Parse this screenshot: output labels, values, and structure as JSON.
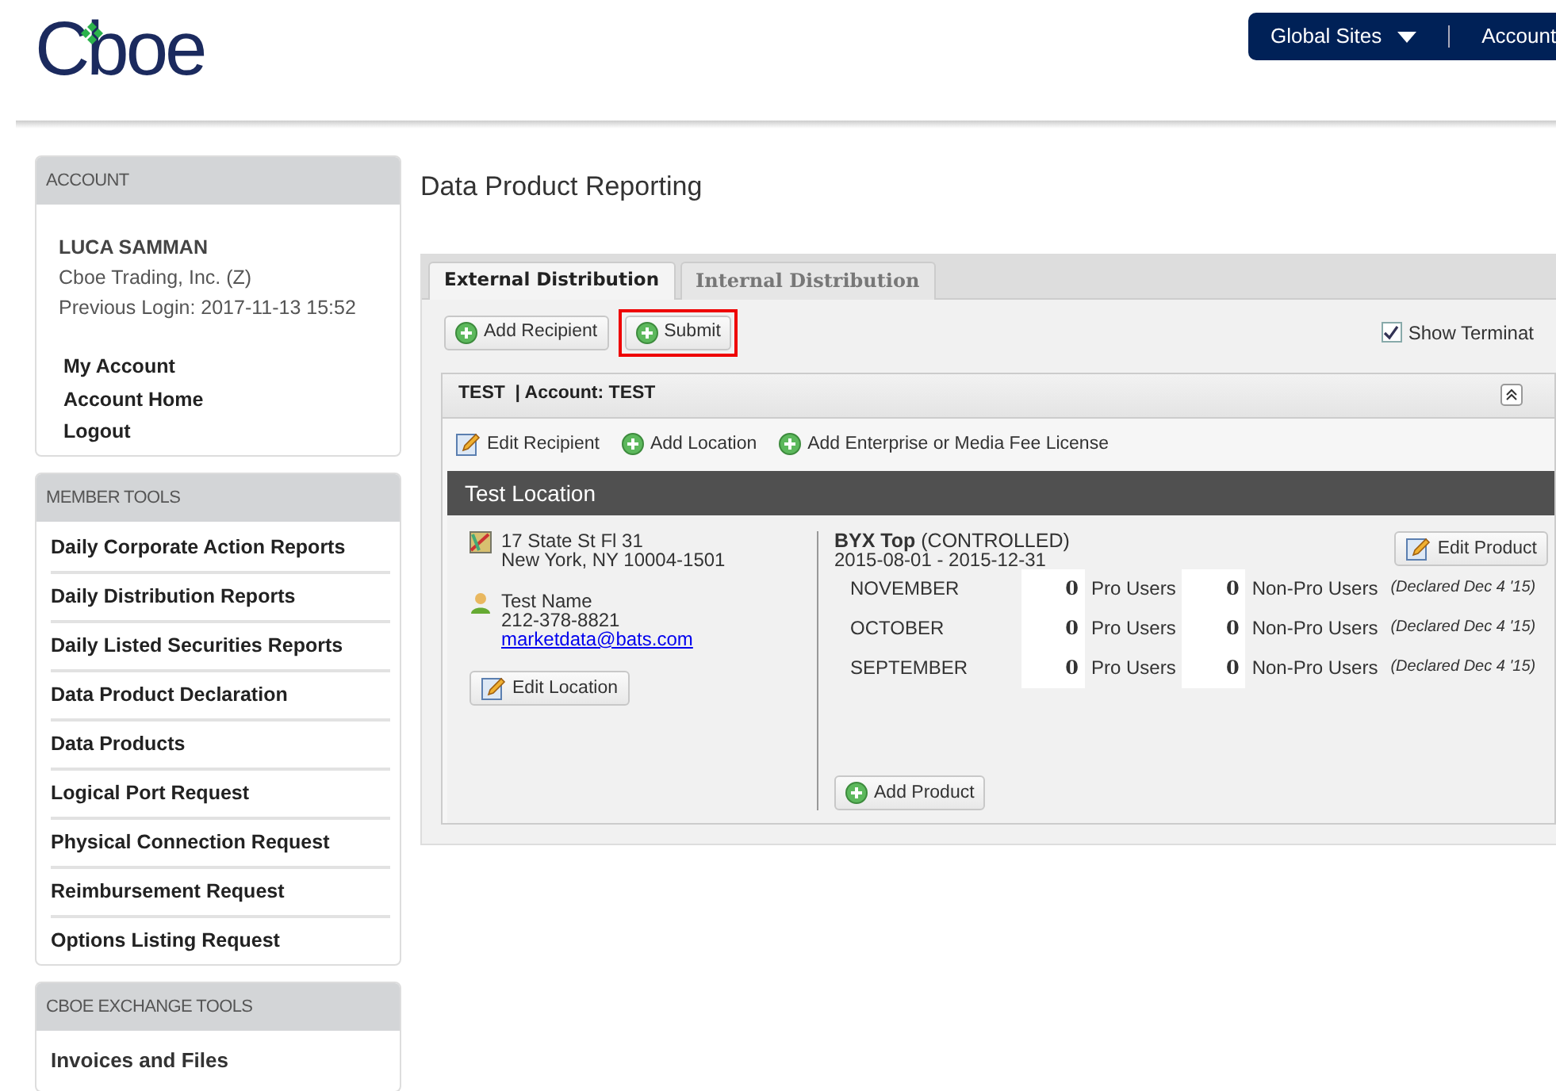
{
  "header": {
    "logo": "Cboe",
    "global_sites": "Global Sites",
    "account_link": "Account"
  },
  "sidebar": [
    {
      "kind": "account",
      "title": "ACCOUNT",
      "user": "LUCA SAMMAN",
      "company": "Cboe Trading, Inc. (Z)",
      "previous_login": "Previous Login: 2017-11-13 15:52",
      "links": [
        "My Account",
        "Account Home",
        "Logout"
      ]
    },
    {
      "kind": "links",
      "title": "MEMBER TOOLS",
      "items": [
        "Daily Corporate Action Reports",
        "Daily Distribution Reports",
        "Daily Listed Securities Reports",
        "Data Product Declaration",
        "Data Products",
        "Logical Port Request",
        "Physical Connection Request",
        "Reimbursement Request",
        "Options Listing Request"
      ]
    },
    {
      "kind": "plain",
      "title": "CBOE EXCHANGE TOOLS",
      "items": [
        "Invoices and Files"
      ]
    }
  ],
  "main": {
    "title": "Data Product Reporting",
    "tabs": [
      {
        "label": "External Distribution",
        "selected": true
      },
      {
        "label": "Internal Distribution",
        "selected": false
      }
    ],
    "buttons": [
      {
        "label": "Add Recipient",
        "highlighted": false
      },
      {
        "label": "Submit",
        "highlighted": true
      }
    ],
    "show_terminated": {
      "label": "Show Terminat",
      "checked": true
    },
    "recipient": {
      "title": "TEST  | Account: TEST",
      "actions": [
        {
          "kind": "edit",
          "label": "Edit Recipient"
        },
        {
          "kind": "add",
          "label": "Add Location"
        },
        {
          "kind": "add",
          "label": "Add Enterprise or Media Fee License"
        }
      ],
      "location": {
        "title": "Test Location",
        "address": [
          "17 State St Fl 31",
          "New York, NY  10004-1501"
        ],
        "contact_name": "Test Name",
        "phone": "212-378-8821",
        "email": "marketdata@bats.com",
        "edit_button": "Edit Location",
        "product": {
          "name": "BYX Top",
          "status": "(CONTROLLED)",
          "dates": "2015-08-01 - 2015-12-31",
          "edit_button": "Edit Product",
          "add_button": "Add Product",
          "rows": [
            {
              "month": "NOVEMBER",
              "pro": "0",
              "pro_label": "Pro Users",
              "nonpro": "0",
              "nonpro_label": "Non-Pro Users",
              "note": "(Declared Dec 4 '15)"
            },
            {
              "month": "OCTOBER",
              "pro": "0",
              "pro_label": "Pro Users",
              "nonpro": "0",
              "nonpro_label": "Non-Pro Users",
              "note": "(Declared Dec 4 '15)"
            },
            {
              "month": "SEPTEMBER",
              "pro": "0",
              "pro_label": "Pro Users",
              "nonpro": "0",
              "nonpro_label": "Non-Pro Users",
              "note": "(Declared Dec 4 '15)"
            }
          ]
        }
      }
    }
  }
}
